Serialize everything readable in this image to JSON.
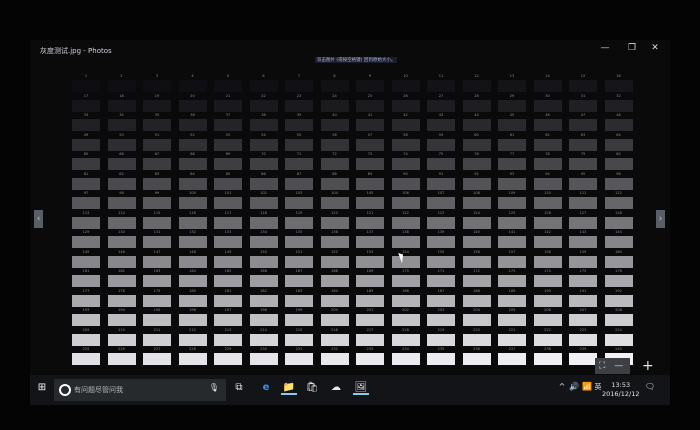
{
  "window": {
    "title": "灰度测试.jpg - Photos",
    "hint": "双击图片 (或按空格键) 回到原始大小。",
    "minimize_icon": "minimize-icon",
    "maximize_icon": "restore-icon",
    "close_icon": "close-icon"
  },
  "controls": {
    "min": "—",
    "max": "❐",
    "close": "✕",
    "prev": "‹",
    "next": "›",
    "fit": "⛶",
    "zoom_minus": "—",
    "zoom_plus": "+"
  },
  "image": {
    "grid_labels": [
      [
        1,
        2,
        3,
        4,
        5,
        6,
        7,
        8,
        9,
        10,
        11,
        12,
        13,
        14,
        15,
        16
      ],
      [
        17,
        18,
        19,
        20,
        21,
        22,
        23,
        24,
        25,
        26,
        27,
        28,
        29,
        30,
        31,
        32
      ],
      [
        33,
        34,
        35,
        36,
        37,
        38,
        39,
        40,
        41,
        42,
        43,
        44,
        45,
        46,
        47,
        48
      ],
      [
        49,
        50,
        51,
        52,
        53,
        54,
        55,
        56,
        57,
        58,
        59,
        60,
        61,
        62,
        63,
        64
      ],
      [
        65,
        66,
        67,
        68,
        69,
        70,
        71,
        72,
        73,
        74,
        75,
        76,
        77,
        78,
        79,
        80
      ],
      [
        81,
        82,
        83,
        84,
        85,
        86,
        87,
        88,
        89,
        90,
        91,
        92,
        93,
        94,
        95,
        96
      ],
      [
        97,
        98,
        99,
        100,
        101,
        102,
        103,
        104,
        105,
        106,
        107,
        108,
        109,
        110,
        111,
        112
      ],
      [
        113,
        114,
        115,
        116,
        117,
        118,
        119,
        120,
        121,
        122,
        123,
        124,
        125,
        126,
        127,
        128
      ],
      [
        129,
        130,
        131,
        132,
        133,
        134,
        135,
        136,
        137,
        138,
        139,
        140,
        141,
        142,
        143,
        144
      ],
      [
        145,
        146,
        147,
        148,
        149,
        150,
        151,
        152,
        153,
        154,
        155,
        156,
        157,
        158,
        159,
        160
      ],
      [
        161,
        162,
        163,
        164,
        165,
        166,
        167,
        168,
        169,
        170,
        171,
        172,
        173,
        174,
        175,
        176
      ],
      [
        177,
        178,
        179,
        180,
        181,
        182,
        183,
        184,
        185,
        186,
        187,
        188,
        189,
        190,
        191,
        192
      ],
      [
        193,
        194,
        195,
        196,
        197,
        198,
        199,
        200,
        201,
        202,
        203,
        204,
        205,
        206,
        207,
        208
      ],
      [
        209,
        210,
        211,
        212,
        213,
        214,
        215,
        216,
        217,
        218,
        219,
        220,
        221,
        222,
        223,
        224
      ],
      [
        225,
        226,
        227,
        228,
        229,
        230,
        231,
        232,
        233,
        234,
        235,
        236,
        237,
        238,
        239,
        240
      ]
    ]
  },
  "taskbar": {
    "start": "⊞",
    "search_placeholder": "有问题尽管问我",
    "mic": "🎙",
    "task_view": "⧉",
    "edge": "e",
    "explorer": "📁",
    "store": "🛍",
    "app": "☁",
    "photos": "🖼",
    "tray_up": "^",
    "volume": "🔊",
    "network": "📶",
    "ime": "英",
    "time": "13:53",
    "date": "2016/12/12",
    "notifications": "🗨"
  }
}
